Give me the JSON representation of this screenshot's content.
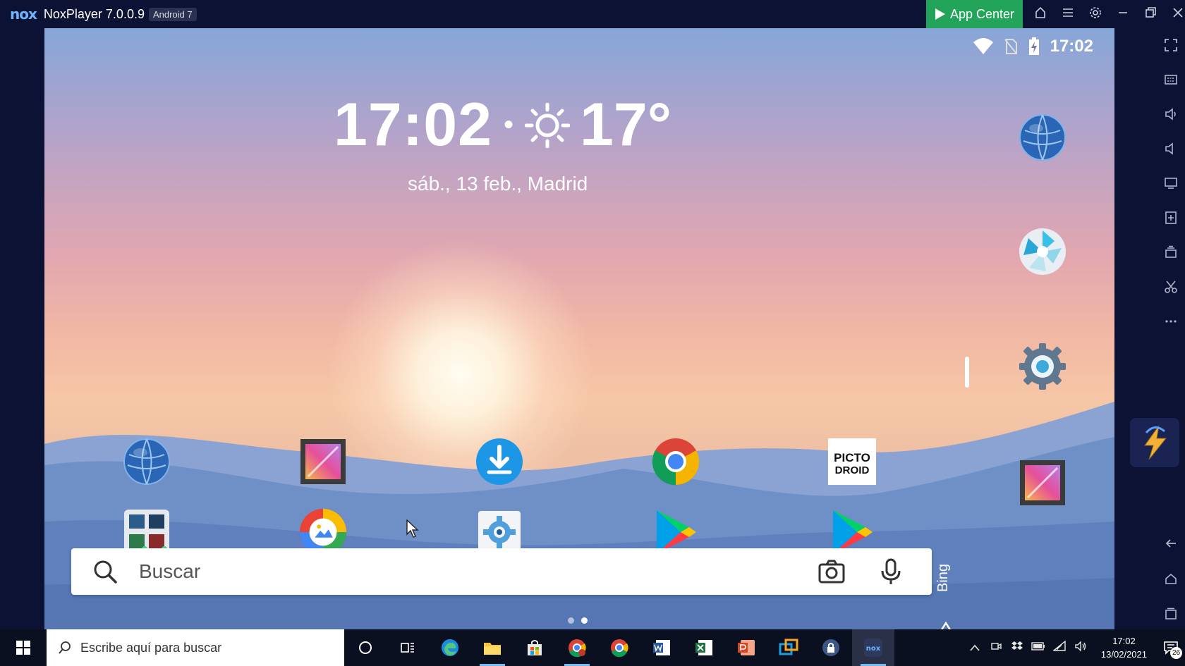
{
  "titlebar": {
    "logo": "nox",
    "title": "NoxPlayer 7.0.0.9",
    "android_badge": "Android 7",
    "app_center": "App Center",
    "icons": [
      "home-icon",
      "menu-icon",
      "gear-icon",
      "minimize-icon",
      "restore-icon",
      "close-icon"
    ]
  },
  "android": {
    "status_time": "17:02",
    "clock": "17:02",
    "separator": "•",
    "temperature": "17°",
    "date": "sáb., 13 feb., Madrid",
    "search_placeholder": "Buscar",
    "bing_label": "Bing",
    "apps": [
      "browser-globe-icon",
      "gallery-icon",
      "download-icon",
      "chrome-icon",
      "pictodroid-icon",
      "multi-app-icon",
      "photos-icon",
      "settings-app-icon",
      "play-store-icon",
      "play-store-icon"
    ],
    "pictodroid_text": [
      "PICTO",
      "DROID"
    ],
    "page_count": 2,
    "active_page": 2
  },
  "taskbar": {
    "search_text": "Escribe aquí para buscar",
    "clock_time": "17:02",
    "clock_date": "13/02/2021",
    "notification_count": "26"
  },
  "colors": {
    "app_center_green": "#22a45a",
    "frame": "#0c1233",
    "nox_blue": "#6fb4ff"
  }
}
